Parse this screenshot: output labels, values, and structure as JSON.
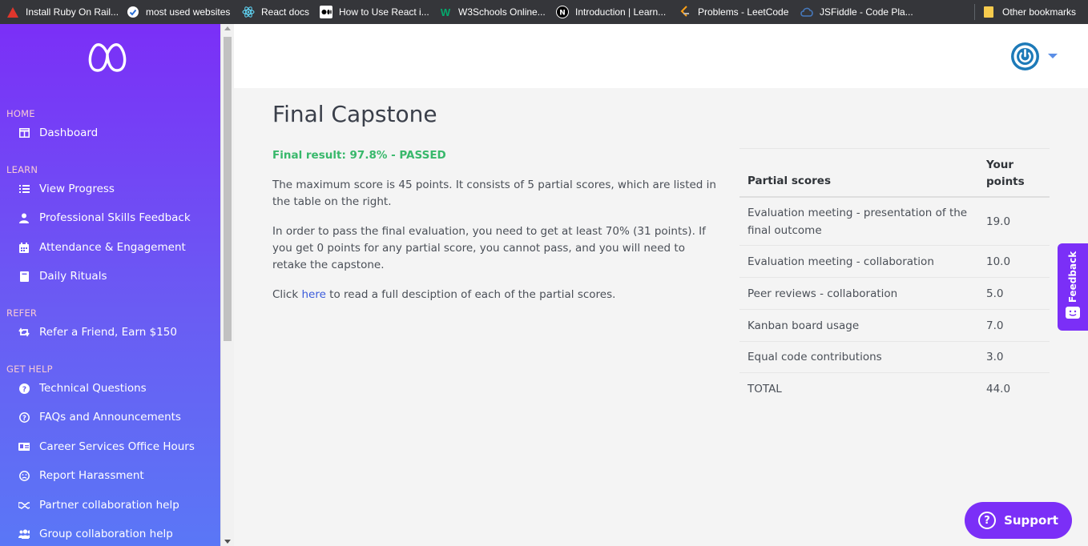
{
  "bookmarks": [
    {
      "label": "Install Ruby On Rail...",
      "icon": "ruby-triangle-icon"
    },
    {
      "label": "most used websites",
      "icon": "check-circle-icon"
    },
    {
      "label": "React docs",
      "icon": "react-icon"
    },
    {
      "label": "How to Use React i...",
      "icon": "medium-icon"
    },
    {
      "label": "W3Schools Online...",
      "icon": "w3schools-icon"
    },
    {
      "label": "Introduction | Learn...",
      "icon": "nextjs-icon"
    },
    {
      "label": "Problems - LeetCode",
      "icon": "leetcode-icon"
    },
    {
      "label": "JSFiddle - Code Pla...",
      "icon": "jsfiddle-icon"
    }
  ],
  "other_bookmarks": "Other bookmarks",
  "sidebar": {
    "sections": [
      {
        "label": "HOME",
        "items": [
          {
            "label": "Dashboard",
            "icon": "columns-icon"
          }
        ]
      },
      {
        "label": "LEARN",
        "items": [
          {
            "label": "View Progress",
            "icon": "list-icon"
          },
          {
            "label": "Professional Skills Feedback",
            "icon": "user-icon"
          },
          {
            "label": "Attendance & Engagement",
            "icon": "calendar-icon"
          },
          {
            "label": "Daily Rituals",
            "icon": "book-icon"
          }
        ]
      },
      {
        "label": "REFER",
        "items": [
          {
            "label": "Refer a Friend, Earn $150",
            "icon": "retweet-icon"
          }
        ]
      },
      {
        "label": "GET HELP",
        "items": [
          {
            "label": "Technical Questions",
            "icon": "question-circle-icon"
          },
          {
            "label": "FAQs and Announcements",
            "icon": "question-outline-icon"
          },
          {
            "label": "Career Services Office Hours",
            "icon": "id-card-icon"
          },
          {
            "label": "Report Harassment",
            "icon": "frown-icon"
          },
          {
            "label": "Partner collaboration help",
            "icon": "handshake-icon"
          },
          {
            "label": "Group collaboration help",
            "icon": "users-icon"
          }
        ]
      }
    ]
  },
  "main": {
    "title": "Final Capstone",
    "result": "Final result: 97.8% - PASSED",
    "para1": "The maximum score is 45 points. It consists of 5 partial scores, which are listed in the table on the right.",
    "para2": "In order to pass the final evaluation, you need to get at least 70% (31 points). If you get 0 points for any partial score, you cannot pass, and you will need to retake the capstone.",
    "para3_before": "Click ",
    "para3_link": "here",
    "para3_after": " to read a full desciption of each of the partial scores."
  },
  "table": {
    "col1": "Partial scores",
    "col2": "Your points",
    "rows": [
      {
        "name": "Evaluation meeting - presentation of the final outcome",
        "points": "19.0"
      },
      {
        "name": "Evaluation meeting - collaboration",
        "points": "10.0"
      },
      {
        "name": "Peer reviews - collaboration",
        "points": "5.0"
      },
      {
        "name": "Kanban board usage",
        "points": "7.0"
      },
      {
        "name": "Equal code contributions",
        "points": "3.0"
      },
      {
        "name": "TOTAL",
        "points": "44.0"
      }
    ]
  },
  "feedback_label": "Feedback",
  "support_label": "Support",
  "colors": {
    "accent": "#7b2ff7",
    "passed": "#38b86b",
    "link": "#3b5bdb"
  }
}
